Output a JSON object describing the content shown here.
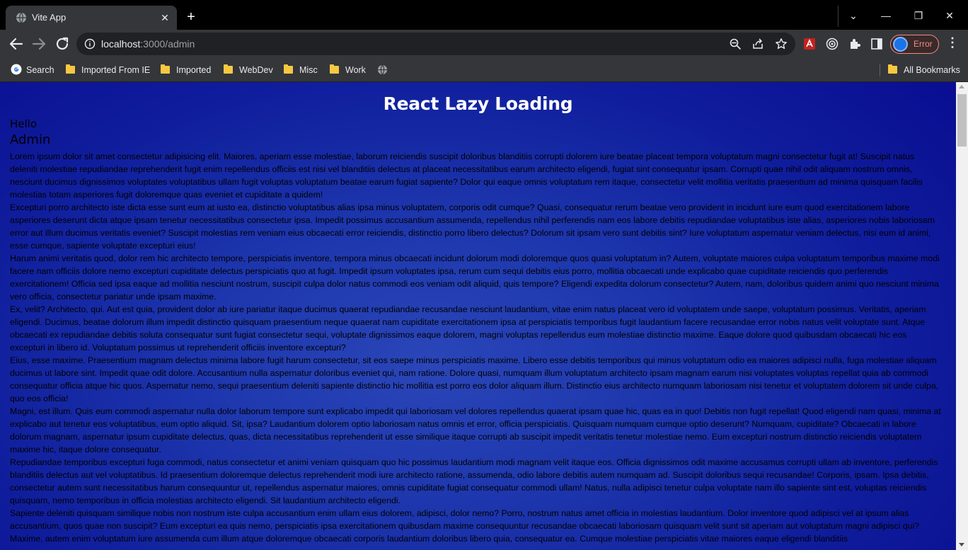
{
  "browser": {
    "tab": {
      "title": "Vite App",
      "close_glyph": "✕"
    },
    "new_tab_glyph": "+",
    "window_controls": {
      "tab_search": "⌄",
      "minimize": "—",
      "restore": "❐",
      "close": "✕"
    },
    "address": {
      "host": "localhost",
      "rest": ":3000/admin"
    },
    "profile": {
      "label": "Error",
      "accent": "#f28b82"
    },
    "menu_glyph": "⋮",
    "bookmarks": [
      {
        "label": "Search",
        "icon": "google-icon"
      },
      {
        "label": "Imported From IE",
        "icon": "folder-icon"
      },
      {
        "label": "Imported",
        "icon": "folder-icon"
      },
      {
        "label": "WebDev",
        "icon": "folder-icon"
      },
      {
        "label": "Misc",
        "icon": "folder-icon"
      },
      {
        "label": "Work",
        "icon": "folder-icon"
      },
      {
        "label": "",
        "icon": "globe-icon"
      }
    ],
    "all_bookmarks": "All Bookmarks"
  },
  "page": {
    "title": "React Lazy Loading",
    "hello": "Hello",
    "admin": "Admin",
    "paragraphs": [
      "Lorem ipsum dolor sit amet consectetur adipisicing elit. Maiores, aperiam esse molestiae, laborum reiciendis suscipit doloribus blanditiis corrupti dolorem iure beatae placeat tempora voluptatum magni consectetur fugit at! Suscipit natus deleniti molestiae repudiandae reprehenderit fugit enim repellendus officiis est nisi vel blanditiis delectus at placeat necessitatibus earum architecto eligendi, fugiat sint consequatur ipsam. Corrupti quae nihil odit aliquam nostrum omnis, nesciunt ducimus dignissimos voluptates voluptatibus ullam fugit voluptas voluptatum beatae earum fugiat sapiente? Dolor qui eaque omnis voluptatum rem itaque, consectetur velit mollitia veritatis praesentium ad minima quisquam facilis molestias totam asperiores fugit doloremque quas eveniet et cupiditate a quidem!",
      "Excepturi porro architecto iste dicta esse sunt eum at iusto ea, distinctio voluptatibus alias ipsa minus voluptatem, corporis odit cumque? Quasi, consequatur rerum beatae vero provident in incidunt iure eum quod exercitationem labore asperiores deserunt dicta atque ipsam tenetur necessitatibus consectetur ipsa. Impedit possimus accusantium assumenda, repellendus nihil perferendis nam eos labore debitis repudiandae voluptatibus iste alias, asperiores nobis laboriosam error aut illum ducimus veritatis eveniet? Suscipit molestias rem veniam eius obcaecati error reiciendis, distinctio porro libero delectus? Dolorum sit ipsam vero sunt debitis sint? Iure voluptatum aspernatur veniam delectus, nisi eum id animi, esse cumque, sapiente voluptate excepturi eius!",
      "Harum animi veritatis quod, dolor rem hic architecto tempore, perspiciatis inventore, tempora minus obcaecati incidunt dolorum modi doloremque quos quasi voluptatum in? Autem, voluptate maiores culpa voluptatum temporibus maxime modi facere nam officiis dolore nemo excepturi cupiditate delectus perspiciatis quo at fugit. Impedit ipsum voluptates ipsa, rerum cum sequi debitis eius porro, mollitia obcaecati unde explicabo quae cupiditate reiciendis quo perferendis exercitationem! Officia sed ipsa eaque ad mollitia nesciunt nostrum, suscipit culpa dolor natus commodi eos veniam odit aliquid, quis tempore? Eligendi expedita dolorum consectetur? Autem, nam, doloribus quidem animi quo nesciunt minima vero officia, consectetur pariatur unde ipsam maxime.",
      "Ex, velit? Architecto, qui. Aut est quia, provident dolor ab iure pariatur itaque ducimus quaerat repudiandae recusandae nesciunt laudantium, vitae enim natus placeat vero id voluptatem unde saepe, voluptatum possimus. Veritatis, aperiam eligendi. Ducimus, beatae dolorum illum impedit distinctio quisquam praesentium neque quaerat nam cupiditate exercitationem ipsa at perspiciatis temporibus fugit laudantium facere recusandae error nobis natus velit voluptate sunt. Atque obcaecati ex repudiandae debitis soluta consequatur sunt fugiat consectetur sequi, voluptate dignissimos eaque dolorem, magni voluptas repellendus eum molestiae distinctio maxime. Eaque dolore quod quibusdam obcaecati hic eos excepturi in libero id. Voluptatum possimus ut reprehenderit officiis inventore excepturi?",
      "Eius, esse maxime. Praesentium magnam delectus minima labore fugit harum consectetur, sit eos saepe minus perspiciatis maxime. Libero esse debitis temporibus qui minus voluptatum odio ea maiores adipisci nulla, fuga molestiae aliquam ducimus ut labore sint. Impedit quae odit dolore. Accusantium nulla aspernatur doloribus eveniet qui, nam ratione. Dolore quasi, numquam illum voluptatum architecto ipsam magnam earum nisi voluptates voluptas repellat quia ab commodi consequatur officia atque hic quos. Aspernatur nemo, sequi praesentium deleniti sapiente distinctio hic mollitia est porro eos dolor aliquam illum. Distinctio eius architecto numquam laboriosam nisi tenetur et voluptatem dolorem sit unde culpa, quo eos officia!",
      "Magni, est illum. Quis eum commodi aspernatur nulla dolor laborum tempore sunt explicabo impedit qui laboriosam vel dolores repellendus quaerat ipsam quae hic, quas ea in quo! Debitis non fugit repellat! Quod eligendi nam quasi, minima at explicabo aut tenetur eos voluptatibus, eum optio aliquid. Sit, ipsa? Laudantium dolorem optio laboriosam natus omnis et error, officia perspiciatis. Quisquam numquam cumque optio deserunt? Numquam, cupiditate? Obcaecati in labore dolorum magnam, aspernatur ipsum cupiditate delectus, quas, dicta necessitatibus reprehenderit ut esse similique itaque corrupti ab suscipit impedit veritatis tenetur molestiae nemo. Eum excepturi nostrum distinctio reiciendis voluptatem maxime hic, itaque dolore consequatur.",
      "Repudiandae temporibus excepturi fuga commodi, natus consectetur et animi veniam quisquam quo hic possimus laudantium modi magnam velit itaque eos. Officia dignissimos odit maxime accusamus corrupti ullam ab inventore, perferendis blanditiis delectus aut vel voluptatibus. Id praesentium doloremque delectus reprehenderit modi iure architecto ratione, assumenda, odio labore debitis autem numquam ad. Suscipit doloribus sequi recusandae! Corporis, ipsam. Ipsa debitis, consectetur autem sunt necessitatibus harum consequuntur ut, repellendus aspernatur maiores, omnis cupiditate fugiat consequatur commodi ullam! Natus, nulla adipisci tenetur culpa voluptate nam illo sapiente sint est, voluptas reiciendis quisquam, nemo temporibus in officia molestias architecto eligendi. Sit laudantium architecto eligendi.",
      "Sapiente deleniti quisquam similique nobis non nostrum iste culpa accusantium enim ullam eius dolorem, adipisci, dolor nemo? Porro, nostrum natus amet officia in molestias laudantium. Dolor inventore quod adipisci vel at ipsum alias accusantium, quos quae non suscipit? Eum excepturi ea quis nemo, perspiciatis ipsa exercitationem quibusdam maxime consequuntur recusandae obcaecati laboriosam quisquam velit sunt sit aperiam aut voluptatum magni adipisci qui? Maxime, autem enim voluptatum iure assumenda cum illum atque doloremque obcaecati corporis laudantium doloribus libero quia, consequatur ea. Cumque molestiae perspiciatis vitae maiores eaque eligendi blanditiis"
    ]
  }
}
